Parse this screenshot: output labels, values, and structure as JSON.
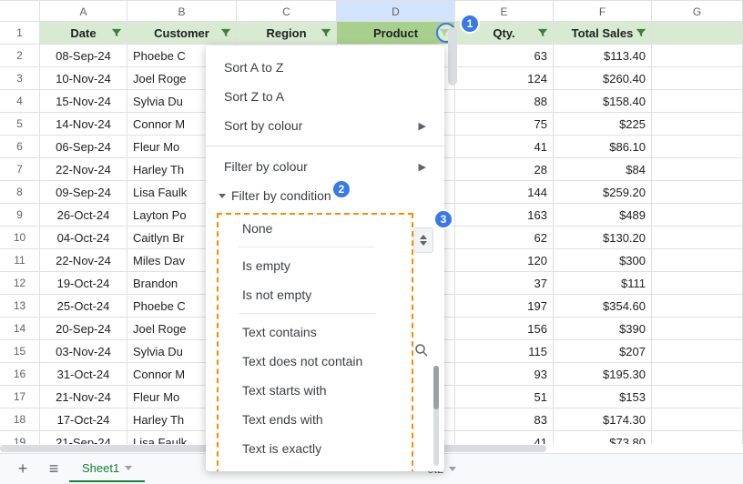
{
  "columns": [
    "A",
    "B",
    "C",
    "D",
    "E",
    "F",
    "G"
  ],
  "selected_column_index": 3,
  "headers": {
    "A": "Date",
    "B": "Customer",
    "C": "Region",
    "D": "Product",
    "E": "Qty.",
    "F": "Total Sales",
    "G": ""
  },
  "rows": [
    {
      "n": 2,
      "date": "08-Sep-24",
      "customer": "Phoebe C",
      "qty": 63,
      "total": "$113.40"
    },
    {
      "n": 3,
      "date": "10-Nov-24",
      "customer": "Joel Roge",
      "qty": 124,
      "total": "$260.40"
    },
    {
      "n": 4,
      "date": "15-Nov-24",
      "customer": "Sylvia Du",
      "qty": 88,
      "total": "$158.40"
    },
    {
      "n": 5,
      "date": "14-Nov-24",
      "customer": "Connor M",
      "qty": 75,
      "total": "$225"
    },
    {
      "n": 6,
      "date": "06-Sep-24",
      "customer": "Fleur Mo",
      "qty": 41,
      "total": "$86.10"
    },
    {
      "n": 7,
      "date": "22-Nov-24",
      "customer": "Harley Th",
      "qty": 28,
      "total": "$84"
    },
    {
      "n": 8,
      "date": "09-Sep-24",
      "customer": "Lisa Faulk",
      "qty": 144,
      "total": "$259.20"
    },
    {
      "n": 9,
      "date": "26-Oct-24",
      "customer": "Layton Po",
      "qty": 163,
      "total": "$489"
    },
    {
      "n": 10,
      "date": "04-Oct-24",
      "customer": "Caitlyn Br",
      "qty": 62,
      "total": "$130.20"
    },
    {
      "n": 11,
      "date": "22-Nov-24",
      "customer": "Miles Dav",
      "qty": 120,
      "total": "$300"
    },
    {
      "n": 12,
      "date": "19-Oct-24",
      "customer": "Brandon",
      "qty": 37,
      "total": "$111"
    },
    {
      "n": 13,
      "date": "25-Oct-24",
      "customer": "Phoebe C",
      "qty": 197,
      "total": "$354.60"
    },
    {
      "n": 14,
      "date": "20-Sep-24",
      "customer": "Joel Roge",
      "qty": 156,
      "total": "$390"
    },
    {
      "n": 15,
      "date": "03-Nov-24",
      "customer": "Sylvia Du",
      "qty": 115,
      "total": "$207"
    },
    {
      "n": 16,
      "date": "31-Oct-24",
      "customer": "Connor M",
      "qty": 93,
      "total": "$195.30"
    },
    {
      "n": 17,
      "date": "21-Nov-24",
      "customer": "Fleur Mo",
      "qty": 51,
      "total": "$153"
    },
    {
      "n": 18,
      "date": "17-Oct-24",
      "customer": "Harley Th",
      "qty": 83,
      "total": "$174.30"
    },
    {
      "n": 19,
      "date": "21-Sep-24",
      "customer": "Lisa Faulk",
      "qty": 41,
      "total": "$73.80"
    }
  ],
  "filter_menu": {
    "sort_az": "Sort A to Z",
    "sort_za": "Sort Z to A",
    "sort_colour": "Sort by colour",
    "filter_colour": "Filter by colour",
    "filter_condition": "Filter by condition",
    "conditions": [
      "None",
      "Is empty",
      "Is not empty",
      "Text contains",
      "Text does not contain",
      "Text starts with",
      "Text ends with",
      "Text is exactly"
    ]
  },
  "callouts": {
    "c1": "1",
    "c2": "2",
    "c3": "3"
  },
  "tabs": {
    "add": "+",
    "all": "≡",
    "sheet1": "Sheet1",
    "sheet2": "et2"
  },
  "icons": {
    "filter": "filter-icon"
  }
}
